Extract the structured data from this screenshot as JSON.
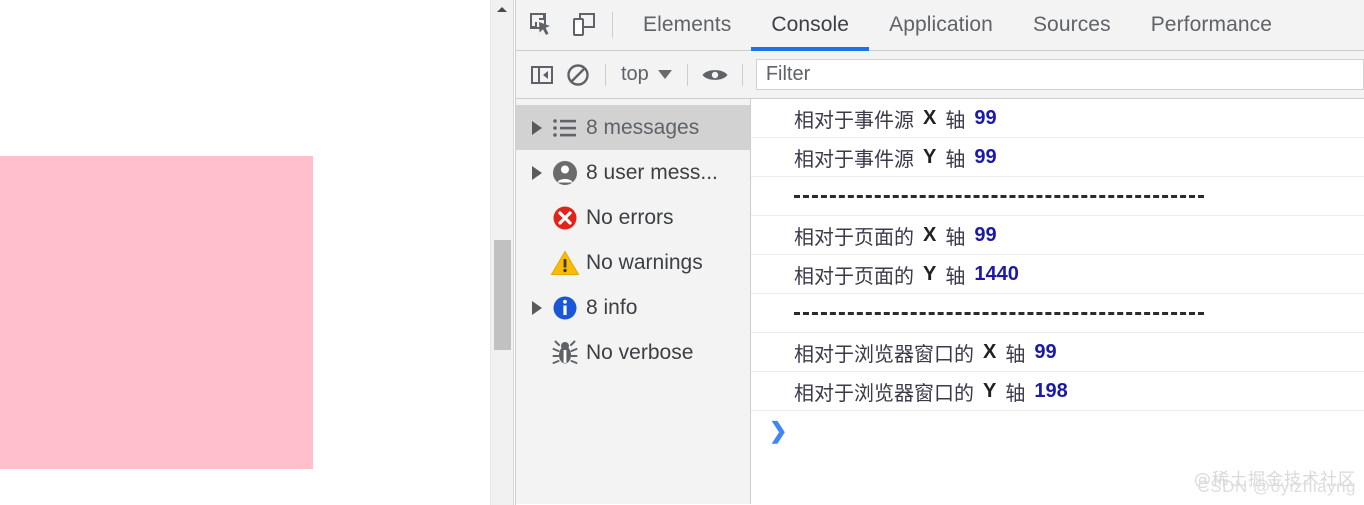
{
  "page": {
    "pink_box_color": "#ffc0cb",
    "scrollbar": {
      "thumb_color": "#c1c1c1",
      "track_color": "#f1f1f1"
    }
  },
  "devtools": {
    "toolbar_icons": [
      {
        "name": "inspect-element-icon",
        "label": "Inspect element"
      },
      {
        "name": "device-toolbar-icon",
        "label": "Toggle device toolbar"
      }
    ],
    "tabs": [
      {
        "label": "Elements",
        "active": false
      },
      {
        "label": "Console",
        "active": true
      },
      {
        "label": "Application",
        "active": false
      },
      {
        "label": "Sources",
        "active": false
      },
      {
        "label": "Performance",
        "active": false
      }
    ],
    "active_tab_underline_color": "#1a73e8",
    "filterbar": {
      "sidebar_toggle_label": "Show console sidebar",
      "clear_console_label": "Clear console",
      "context": "top",
      "eye_label": "Create live expression",
      "filter_placeholder": "Filter",
      "filter_value": ""
    },
    "sidebar": {
      "items": [
        {
          "label": "8 messages",
          "icon": "list-icon",
          "twisty": true,
          "selected": true
        },
        {
          "label": "8 user mess...",
          "icon": "user-icon",
          "twisty": true,
          "selected": false
        },
        {
          "label": "No errors",
          "icon": "error-icon",
          "twisty": false,
          "selected": false
        },
        {
          "label": "No warnings",
          "icon": "warning-icon",
          "twisty": false,
          "selected": false
        },
        {
          "label": "8 info",
          "icon": "info-icon",
          "twisty": true,
          "selected": false
        },
        {
          "label": "No verbose",
          "icon": "verbose-bug-icon",
          "twisty": false,
          "selected": false
        }
      ]
    },
    "console_rows": [
      {
        "type": "log",
        "text": "相对于事件源",
        "axis": "X",
        "unit": "轴",
        "value": "99"
      },
      {
        "type": "log",
        "text": "相对于事件源",
        "axis": "Y",
        "unit": "轴",
        "value": "99"
      },
      {
        "type": "divider"
      },
      {
        "type": "log",
        "text": "相对于页面的",
        "axis": "X",
        "unit": "轴",
        "value": "99"
      },
      {
        "type": "log",
        "text": "相对于页面的",
        "axis": "Y",
        "unit": "轴",
        "value": "1440"
      },
      {
        "type": "divider"
      },
      {
        "type": "log",
        "text": "相对于浏览器窗口的",
        "axis": "X",
        "unit": "轴",
        "value": "99"
      },
      {
        "type": "log",
        "text": "相对于浏览器窗口的",
        "axis": "Y",
        "unit": "轴",
        "value": "198"
      }
    ],
    "prompt": {
      "chevron": "❯"
    }
  },
  "watermark": {
    "line1": "@稀土掘金技术社区",
    "line2": "CSDN @oyizhiayng"
  }
}
